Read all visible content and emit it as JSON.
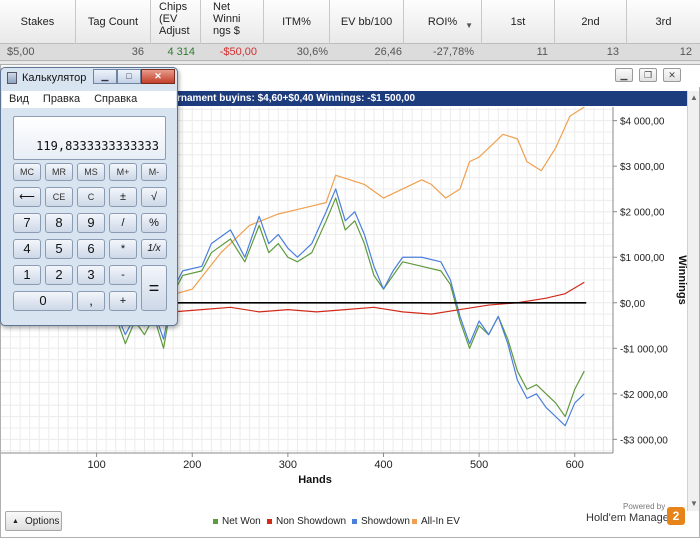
{
  "stats_table": {
    "headers": [
      "Stakes",
      "Tag Count",
      "Chips\n(EV\nAdjust",
      "Net\nWinni\nngs $",
      "ITM%",
      "EV bb/100",
      "ROI%",
      "1st",
      "2nd",
      "3rd"
    ],
    "row": {
      "stakes": "$5,00",
      "tag_count": "36",
      "chips_ev": "4 314",
      "net_winnings": "-$50,00",
      "itm": "30,6%",
      "ev_bb100": "26,46",
      "roi": "-27,78%",
      "first": "11",
      "second": "13",
      "third": "12"
    }
  },
  "chart_window": {
    "title": "rnament buyins: $4,60+$0,40  Winnings: -$1 500,00"
  },
  "chart_data": {
    "type": "line",
    "xlabel": "Hands",
    "ylabel": "Winnings",
    "xlim": [
      0,
      640
    ],
    "ylim": [
      -3300,
      4300
    ],
    "x_ticks": [
      100,
      200,
      300,
      400,
      500,
      600
    ],
    "x_tick_labels": [
      "100",
      "200",
      "300",
      "400",
      "500",
      "600"
    ],
    "y_ticks": [
      4000,
      3000,
      2000,
      1000,
      0,
      -1000,
      -2000,
      -3000
    ],
    "y_tick_labels": [
      "$4 000,00",
      "$3 000,00",
      "$2 000,00",
      "$1 000,00",
      "$0,00",
      "-$1 000,00",
      "-$2 000,00",
      "-$3 000,00"
    ],
    "grid": true,
    "legend_position": "bottom",
    "series": [
      {
        "name": "All-In EV",
        "color": "#f0a050",
        "x": [
          120,
          150,
          175,
          200,
          230,
          260,
          290,
          320,
          340,
          350,
          365,
          380,
          400,
          420,
          440,
          450,
          465,
          480,
          490,
          500,
          515,
          525,
          540,
          550,
          565,
          580,
          595,
          610
        ],
        "y": [
          100,
          400,
          150,
          300,
          1100,
          1700,
          1950,
          2100,
          2200,
          2800,
          2700,
          2600,
          2300,
          2500,
          2700,
          2600,
          2300,
          2500,
          3100,
          3200,
          3500,
          3700,
          3600,
          3100,
          2900,
          3400,
          4100,
          4300
        ]
      },
      {
        "name": "Net Won",
        "color": "#5e9a3c",
        "x": [
          120,
          130,
          140,
          150,
          160,
          170,
          180,
          190,
          210,
          220,
          240,
          255,
          270,
          280,
          290,
          300,
          310,
          325,
          340,
          350,
          360,
          370,
          380,
          390,
          400,
          410,
          420,
          440,
          460,
          470,
          480,
          490,
          500,
          510,
          520,
          530,
          540,
          550,
          560,
          570,
          580,
          590,
          600,
          610
        ],
        "y": [
          -300,
          -900,
          -400,
          -700,
          -300,
          -1000,
          200,
          600,
          700,
          1100,
          1400,
          900,
          1700,
          1100,
          1300,
          1000,
          900,
          1100,
          1800,
          2300,
          1600,
          1800,
          1300,
          600,
          300,
          600,
          900,
          800,
          700,
          400,
          -400,
          -1000,
          -500,
          -700,
          -300,
          -800,
          -1500,
          -1900,
          -1800,
          -2000,
          -2200,
          -2500,
          -1900,
          -1500
        ]
      },
      {
        "name": "Showdown",
        "color": "#4a7fdc",
        "x": [
          120,
          130,
          140,
          150,
          160,
          170,
          180,
          190,
          210,
          220,
          240,
          255,
          270,
          280,
          290,
          300,
          310,
          325,
          340,
          350,
          360,
          370,
          380,
          390,
          400,
          410,
          420,
          440,
          460,
          470,
          480,
          490,
          500,
          510,
          520,
          530,
          540,
          550,
          560,
          570,
          580,
          590,
          600,
          610
        ],
        "y": [
          -200,
          -700,
          -300,
          -500,
          -200,
          -800,
          300,
          700,
          800,
          1300,
          1600,
          1000,
          1900,
          1300,
          1500,
          1200,
          1000,
          1300,
          2000,
          2500,
          1800,
          2000,
          1500,
          800,
          300,
          700,
          1000,
          1000,
          900,
          500,
          -300,
          -900,
          -400,
          -700,
          -300,
          -900,
          -1700,
          -2100,
          -2000,
          -2300,
          -2500,
          -2700,
          -2200,
          -2000
        ]
      },
      {
        "name": "Non Showdown",
        "color": "#d12a1a",
        "x": [
          120,
          150,
          180,
          210,
          240,
          270,
          300,
          330,
          360,
          390,
          420,
          450,
          480,
          510,
          540,
          570,
          590,
          610
        ],
        "y": [
          -100,
          -250,
          -200,
          -150,
          -100,
          -200,
          -150,
          -200,
          -150,
          -100,
          -200,
          -250,
          -150,
          -50,
          0,
          100,
          200,
          450
        ]
      },
      {
        "name": "zero-line",
        "color": "#000000",
        "x": [
          0,
          612
        ],
        "y": [
          0,
          0
        ]
      }
    ]
  },
  "legend": [
    {
      "label": "Net Won",
      "color": "#5e9a3c"
    },
    {
      "label": "Non Showdown",
      "color": "#d12a1a"
    },
    {
      "label": "Showdown",
      "color": "#4a7fdc"
    },
    {
      "label": "All-In EV",
      "color": "#f0a050"
    }
  ],
  "footer": {
    "options_label": "Options",
    "powered_by": "Powered by",
    "brand": "Hold'em Manager",
    "brand_logo": "2"
  },
  "calculator": {
    "title": "Калькулятор",
    "menu": [
      "Вид",
      "Правка",
      "Справка"
    ],
    "display": "119,8333333333333",
    "memory_keys": [
      "MC",
      "MR",
      "MS",
      "M+",
      "M-"
    ],
    "keys": {
      "backspace": "⟵",
      "ce": "CE",
      "c": "C",
      "plusminus": "±",
      "sqrt": "√",
      "seven": "7",
      "eight": "8",
      "nine": "9",
      "div": "/",
      "percent": "%",
      "four": "4",
      "five": "5",
      "six": "6",
      "mul": "*",
      "reciprocal": "1/x",
      "one": "1",
      "two": "2",
      "three": "3",
      "minus": "-",
      "equals": "=",
      "zero": "0",
      "comma": ",",
      "plus": "+"
    }
  },
  "colors": {
    "title_bar": "#1d3c7e",
    "chips_positive": "#2e7d32",
    "net_negative": "#d32f2f"
  }
}
